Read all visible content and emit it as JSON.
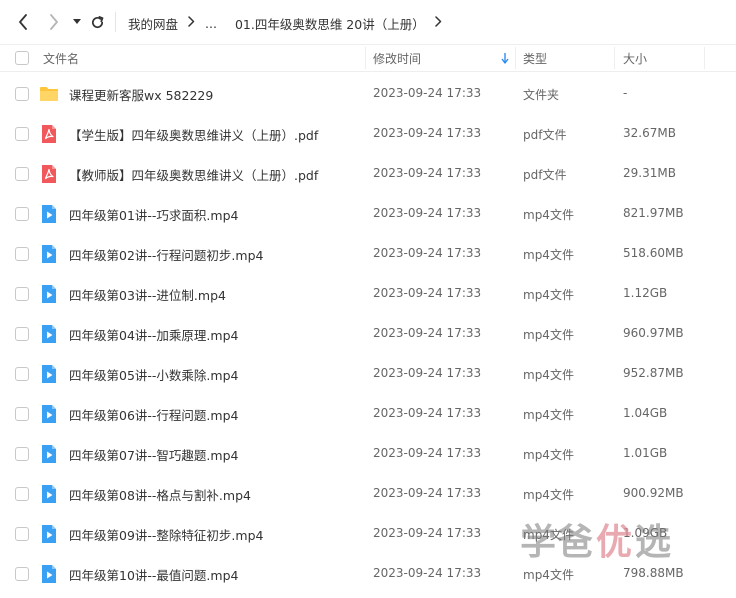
{
  "breadcrumb": {
    "root": "我的网盘",
    "ellipsis": "...",
    "current": "01.四年级奥数思维 20讲（上册）"
  },
  "columns": {
    "name": "文件名",
    "modified": "修改时间",
    "type": "类型",
    "size": "大小"
  },
  "files": [
    {
      "icon": "folder-icon",
      "name": "课程更新客服wx 582229",
      "date": "2023-09-24 17:33",
      "type": "文件夹",
      "size": "-"
    },
    {
      "icon": "pdf-icon",
      "name": "【学生版】四年级奥数思维讲义（上册）.pdf",
      "date": "2023-09-24 17:33",
      "type": "pdf文件",
      "size": "32.67MB"
    },
    {
      "icon": "pdf-icon",
      "name": "【教师版】四年级奥数思维讲义（上册）.pdf",
      "date": "2023-09-24 17:33",
      "type": "pdf文件",
      "size": "29.31MB"
    },
    {
      "icon": "video-icon",
      "name": "四年级第01讲--巧求面积.mp4",
      "date": "2023-09-24 17:33",
      "type": "mp4文件",
      "size": "821.97MB"
    },
    {
      "icon": "video-icon",
      "name": "四年级第02讲--行程问题初步.mp4",
      "date": "2023-09-24 17:33",
      "type": "mp4文件",
      "size": "518.60MB"
    },
    {
      "icon": "video-icon",
      "name": "四年级第03讲--进位制.mp4",
      "date": "2023-09-24 17:33",
      "type": "mp4文件",
      "size": "1.12GB"
    },
    {
      "icon": "video-icon",
      "name": "四年级第04讲--加乘原理.mp4",
      "date": "2023-09-24 17:33",
      "type": "mp4文件",
      "size": "960.97MB"
    },
    {
      "icon": "video-icon",
      "name": "四年级第05讲--小数乘除.mp4",
      "date": "2023-09-24 17:33",
      "type": "mp4文件",
      "size": "952.87MB"
    },
    {
      "icon": "video-icon",
      "name": "四年级第06讲--行程问题.mp4",
      "date": "2023-09-24 17:33",
      "type": "mp4文件",
      "size": "1.04GB"
    },
    {
      "icon": "video-icon",
      "name": "四年级第07讲--智巧趣题.mp4",
      "date": "2023-09-24 17:33",
      "type": "mp4文件",
      "size": "1.01GB"
    },
    {
      "icon": "video-icon",
      "name": "四年级第08讲--格点与割补.mp4",
      "date": "2023-09-24 17:33",
      "type": "mp4文件",
      "size": "900.92MB"
    },
    {
      "icon": "video-icon",
      "name": "四年级第09讲--整除特征初步.mp4",
      "date": "2023-09-24 17:33",
      "type": "mp4文件",
      "size": "1.09GB"
    },
    {
      "icon": "video-icon",
      "name": "四年级第10讲--最值问题.mp4",
      "date": "2023-09-24 17:33",
      "type": "mp4文件",
      "size": "798.88MB"
    }
  ],
  "watermark": {
    "part1": "学爸",
    "part2": "优",
    "part3": "选"
  },
  "colors": {
    "folder": "#FFC53D",
    "pdf": "#F0585C",
    "video": "#3AA0F4",
    "sort_arrow": "#2E8BF0"
  }
}
